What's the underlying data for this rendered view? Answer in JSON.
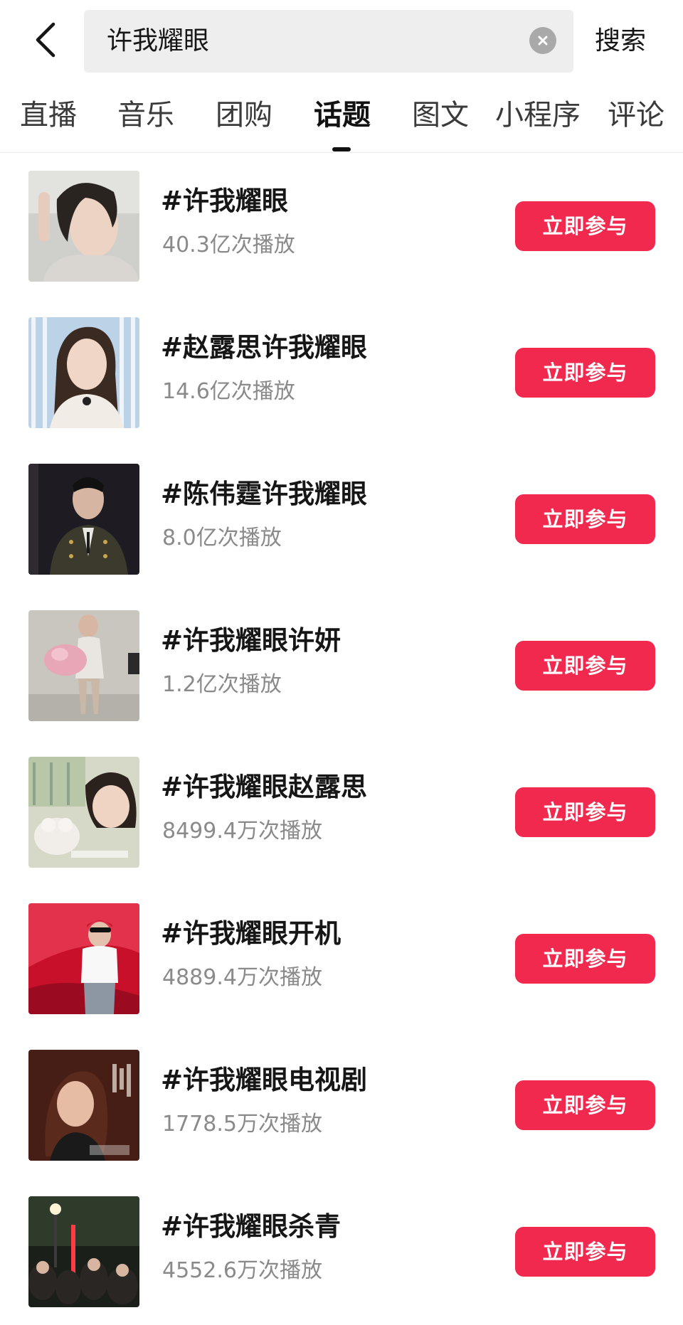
{
  "search": {
    "query": "许我耀眼",
    "submit_label": "搜索"
  },
  "icons": {
    "back": "chevron-left-icon",
    "clear": "close-circle-icon"
  },
  "tabs": [
    {
      "label": "直播",
      "active": false
    },
    {
      "label": "音乐",
      "active": false
    },
    {
      "label": "团购",
      "active": false
    },
    {
      "label": "话题",
      "active": true
    },
    {
      "label": "图文",
      "active": false
    },
    {
      "label": "小程序",
      "active": false
    },
    {
      "label": "评论",
      "active": false
    }
  ],
  "topics": [
    {
      "title": "#许我耀眼",
      "plays": "40.3亿次播放",
      "button": "立即参与"
    },
    {
      "title": "#赵露思许我耀眼",
      "plays": "14.6亿次播放",
      "button": "立即参与"
    },
    {
      "title": "#陈伟霆许我耀眼",
      "plays": "8.0亿次播放",
      "button": "立即参与"
    },
    {
      "title": "#许我耀眼许妍",
      "plays": "1.2亿次播放",
      "button": "立即参与"
    },
    {
      "title": "#许我耀眼赵露思",
      "plays": "8499.4万次播放",
      "button": "立即参与"
    },
    {
      "title": "#许我耀眼开机",
      "plays": "4889.4万次播放",
      "button": "立即参与"
    },
    {
      "title": "#许我耀眼电视剧",
      "plays": "1778.5万次播放",
      "button": "立即参与"
    },
    {
      "title": "#许我耀眼杀青",
      "plays": "4552.6万次播放",
      "button": "立即参与"
    }
  ],
  "colors": {
    "accent": "#f1294e",
    "text_primary": "#161616",
    "text_secondary": "#8a8a8a",
    "search_bg": "#eeeeee"
  }
}
